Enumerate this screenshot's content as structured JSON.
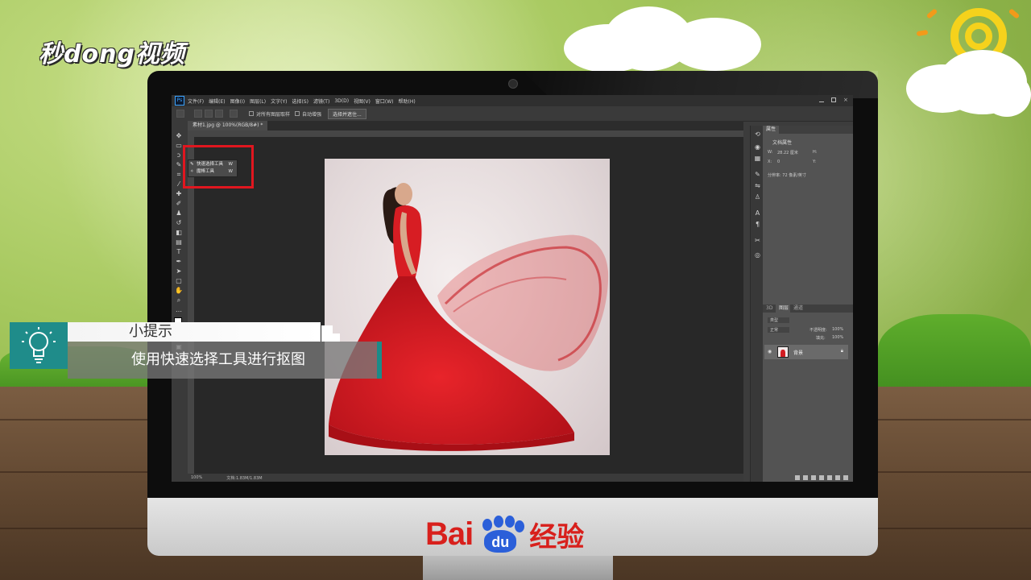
{
  "watermark": {
    "logo_text": "秒dong视频"
  },
  "photoshop": {
    "app_icon": "Ps",
    "menu": [
      "文件(F)",
      "编辑(E)",
      "图像(I)",
      "图层(L)",
      "文字(Y)",
      "选择(S)",
      "滤镜(T)",
      "3D(D)",
      "视图(V)",
      "窗口(W)",
      "帮助(H)"
    ],
    "options": {
      "sample_all_layers": "对所有图层取样",
      "auto_enhance": "自动增强",
      "select_subject_button": "选择并遮住..."
    },
    "document_tab": "素材1.jpg @ 100%(RGB/8#) *",
    "tool_flyout": [
      {
        "label": "快速选择工具",
        "shortcut": "W"
      },
      {
        "label": "魔棒工具",
        "shortcut": "W"
      }
    ],
    "status": {
      "zoom": "100%",
      "doc_info": "文档:1.83M/1.83M"
    },
    "properties": {
      "tab": "属性",
      "title": "文档属性",
      "w_label": "W:",
      "w_value": "28.22 厘米",
      "h_label": "H:",
      "x_label": "X:",
      "x_value": "0",
      "y_label": "Y:",
      "resolution": "分辨率: 72 像素/英寸"
    },
    "layers_panel": {
      "tabs": [
        "3D",
        "图层",
        "通道"
      ],
      "kind_filter": "类型",
      "blend_mode": "正常",
      "opacity_label": "不透明度:",
      "opacity_value": "100%",
      "fill_label": "填充:",
      "fill_value": "100%",
      "layer_name": "背景"
    }
  },
  "tip": {
    "label": "小提示",
    "text": "使用快速选择工具进行抠图"
  },
  "brand": {
    "baidu_left": "Bai",
    "baidu_paw": "du",
    "baidu_cn": "经验"
  },
  "colors": {
    "tip_teal": "#1f8c8a",
    "baidu_red": "#d8201c",
    "baidu_blue": "#2b5fd9",
    "highlight_red": "#e0161f",
    "dress_red": "#d21c22"
  }
}
